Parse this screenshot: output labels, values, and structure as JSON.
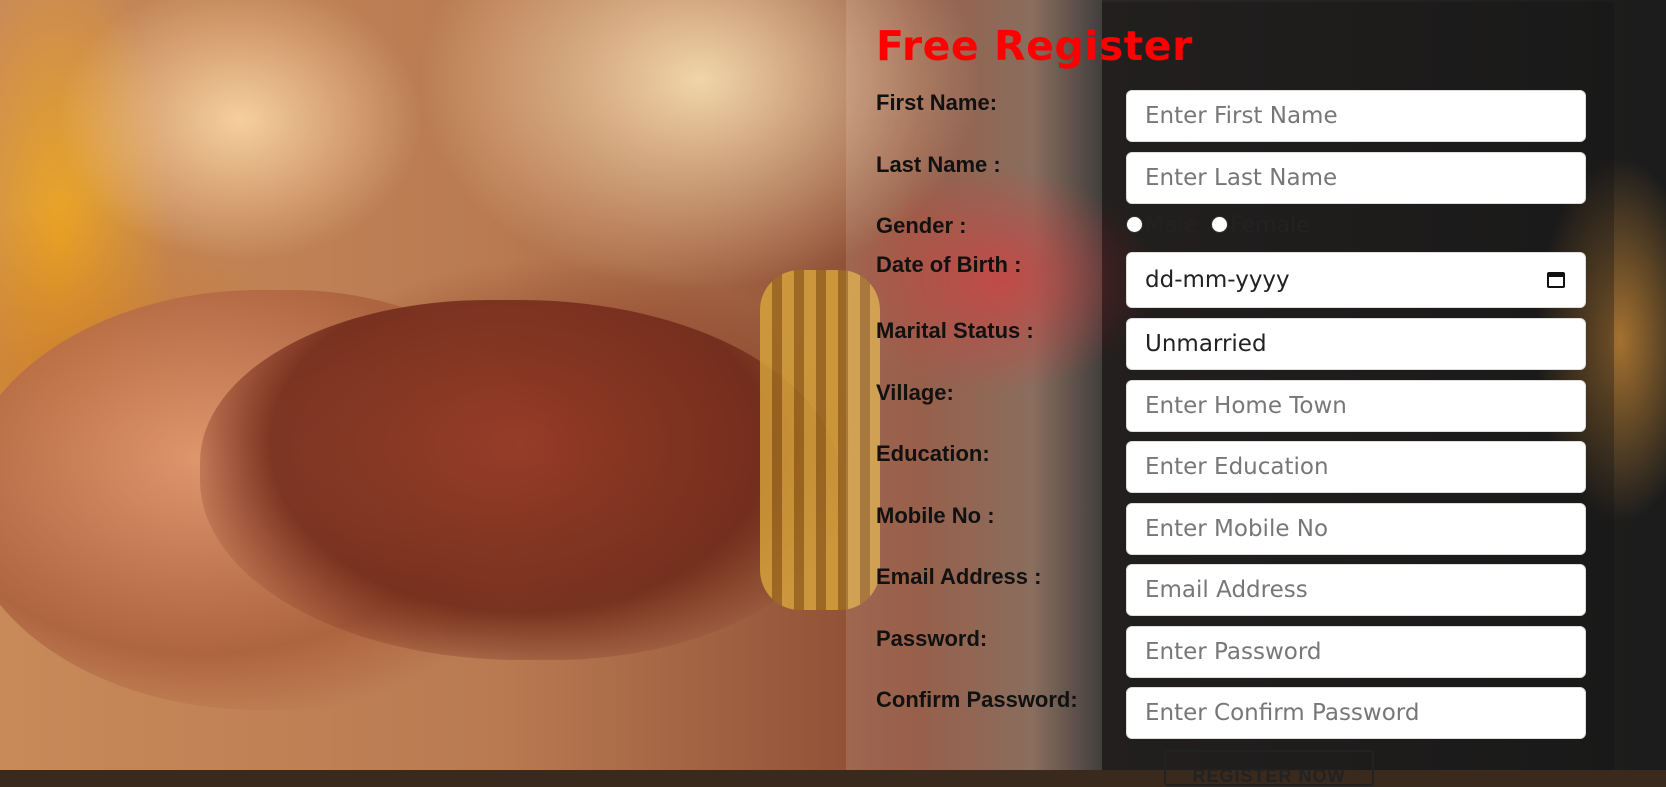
{
  "form": {
    "title": "Free Register",
    "fields": {
      "first_name": {
        "label": "First Name:",
        "placeholder": "Enter First Name"
      },
      "last_name": {
        "label": "Last Name :",
        "placeholder": "Enter Last Name"
      },
      "gender": {
        "label": "Gender :",
        "options": [
          "Male",
          "Female"
        ]
      },
      "dob": {
        "label": "Date of Birth :",
        "placeholder": "dd-mm-yyyy"
      },
      "marital_status": {
        "label": "Marital Status :",
        "value": "Unmarried"
      },
      "village": {
        "label": "Village:",
        "placeholder": "Enter Home Town"
      },
      "education": {
        "label": "Education:",
        "placeholder": "Enter Education"
      },
      "mobile": {
        "label": "Mobile No :",
        "placeholder": "Enter Mobile No"
      },
      "email": {
        "label": "Email Address :",
        "placeholder": "Email Address"
      },
      "password": {
        "label": "Password:",
        "placeholder": "Enter Password"
      },
      "confirm_password": {
        "label": "Confirm Password:",
        "placeholder": "Enter Confirm Password"
      }
    },
    "submit_label": "REGISTER NOW"
  },
  "icons": {
    "date_picker": "calendar-icon"
  },
  "colors": {
    "title": "#ff0000"
  }
}
